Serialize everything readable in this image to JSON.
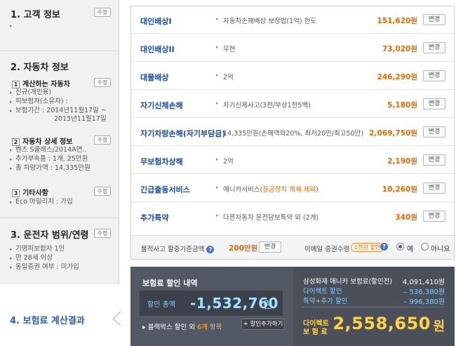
{
  "sidebar": {
    "customer": {
      "title": "1. 고객 정보",
      "edit": "수정",
      "items": [
        ""
      ]
    },
    "vehicle": {
      "title": "2. 자동차 정보",
      "car": {
        "num": "1",
        "title": "계산하는 자동차",
        "edit": "수정",
        "items": [
          "신규(개인용)",
          "피보험자(소유자) :",
          "보험기간 : 2014년11월17일 ~",
          "2015년11월17일"
        ]
      },
      "detail": {
        "num": "2",
        "title": "자동차 상세 정보",
        "edit": "수정",
        "items": [
          "벤츠 S클래스/2014A연..",
          "추가부속품 : 1개, 25만원",
          "총 차량가액 : 14,335만원"
        ]
      },
      "special": {
        "num": "3",
        "title": "기타사항",
        "edit": "수정",
        "items": [
          "Eco 마일리지 : 가입"
        ]
      }
    },
    "driver": {
      "title": "3. 운전자 범위/연령",
      "edit": "수정",
      "items": [
        "기명피보험자 1인",
        "만 28세 이상",
        "동일증권 여부 : 미가입"
      ]
    },
    "result": {
      "title": "4. 보험료 계산결과"
    }
  },
  "coverages": [
    {
      "name": "대인배상I",
      "desc": "자동차손해배상 보장법(1억) 한도",
      "amount": "151,620원",
      "btn": "변경"
    },
    {
      "name": "대인배상II",
      "desc": "무한",
      "amount": "73,020원",
      "btn": "변경"
    },
    {
      "name": "대물배상",
      "desc": "2억",
      "amount": "246,290원",
      "btn": "변경"
    },
    {
      "name": "자기신체손해",
      "desc": "자기신체사고(3천/부상1천5백)",
      "amount": "5,180원",
      "btn": "변경"
    },
    {
      "name": "자기차량손해(자기부담금)",
      "desc": "14,335만원(손해액의20%, 최저20만/최고50만)",
      "amount": "2,069,750원",
      "btn": "변경"
    },
    {
      "name": "무보험차상해",
      "desc": "2억",
      "amount": "2,190원",
      "btn": "변경"
    },
    {
      "name": "긴급출동서비스",
      "desc_prefix": "애니카서비스(",
      "desc_hl": "잠금장치 해제 제외",
      "desc_suffix": ")",
      "amount": "10,260원",
      "btn": "변경"
    },
    {
      "name": "추가특약",
      "desc": "다른자동차 운전담보특약 외 (2개)",
      "amount": "340원",
      "btn": "변경"
    }
  ],
  "property_limit": {
    "label": "물적사고 할증기준금액",
    "help": "?",
    "amount": "200만원",
    "btn": "변경"
  },
  "email": {
    "label": "이메일 증권수령",
    "badge": "1천원 할인",
    "help": "?",
    "yes": "예",
    "no": "아니요"
  },
  "summary": {
    "title": "보험료 할인 내역",
    "disc_label": "할인 총액",
    "disc_value": "-1,532,760",
    "disc_unit": "원",
    "blackbox_text": "블랙박스 할인 외 ",
    "blackbox_count": "6개 항목",
    "add_btn": "할인추가하기",
    "rows": [
      {
        "label": "삼성화재 애니카 보험료(할인전)",
        "value": "4,091,410원",
        "color": "#ffffff"
      },
      {
        "label": "다이렉트 할인",
        "value": "– 536,380원",
        "color": "#7fd0ff"
      },
      {
        "label": "특약+추가 할인",
        "value": "– 996,380원",
        "color": "#7fd0ff"
      }
    ],
    "final_label_1": "다이렉트",
    "final_label_2": "보 험 료",
    "final_value": "2,558,650",
    "final_unit": "원"
  }
}
